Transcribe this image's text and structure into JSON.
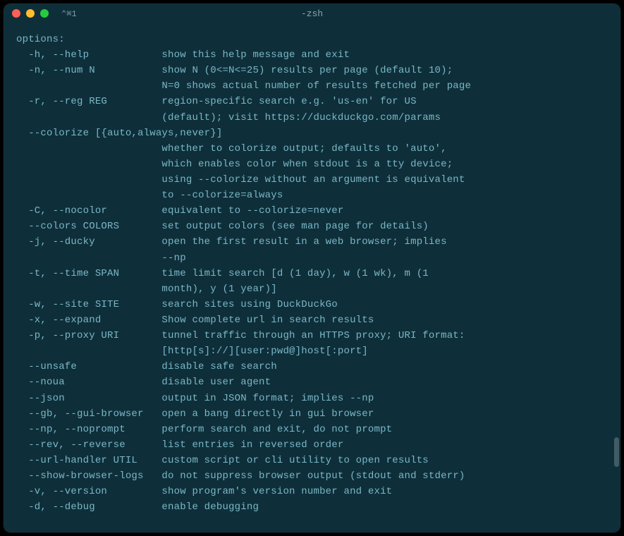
{
  "titlebar": {
    "tab_label": "⌘1",
    "icon_prefix": "⌃",
    "title": "-zsh"
  },
  "terminal": {
    "header": "options:",
    "options": [
      {
        "flag": "  -h, --help",
        "desc": [
          "show this help message and exit"
        ]
      },
      {
        "flag": "  -n, --num N",
        "desc": [
          "show N (0<=N<=25) results per page (default 10);",
          "N=0 shows actual number of results fetched per page"
        ]
      },
      {
        "flag": "  -r, --reg REG",
        "desc": [
          "region-specific search e.g. 'us-en' for US",
          "(default); visit https://duckduckgo.com/params"
        ]
      },
      {
        "flag": "  --colorize [{auto,always,never}]",
        "desc": [],
        "full_line": true
      },
      {
        "flag": "",
        "desc": [
          "whether to colorize output; defaults to 'auto',",
          "which enables color when stdout is a tty device;",
          "using --colorize without an argument is equivalent",
          "to --colorize=always"
        ]
      },
      {
        "flag": "  -C, --nocolor",
        "desc": [
          "equivalent to --colorize=never"
        ]
      },
      {
        "flag": "  --colors COLORS",
        "desc": [
          "set output colors (see man page for details)"
        ]
      },
      {
        "flag": "  -j, --ducky",
        "desc": [
          "open the first result in a web browser; implies",
          "--np"
        ]
      },
      {
        "flag": "  -t, --time SPAN",
        "desc": [
          "time limit search [d (1 day), w (1 wk), m (1",
          "month), y (1 year)]"
        ]
      },
      {
        "flag": "  -w, --site SITE",
        "desc": [
          "search sites using DuckDuckGo"
        ]
      },
      {
        "flag": "  -x, --expand",
        "desc": [
          "Show complete url in search results"
        ]
      },
      {
        "flag": "  -p, --proxy URI",
        "desc": [
          "tunnel traffic through an HTTPS proxy; URI format:",
          "[http[s]://][user:pwd@]host[:port]"
        ]
      },
      {
        "flag": "  --unsafe",
        "desc": [
          "disable safe search"
        ]
      },
      {
        "flag": "  --noua",
        "desc": [
          "disable user agent"
        ]
      },
      {
        "flag": "  --json",
        "desc": [
          "output in JSON format; implies --np"
        ]
      },
      {
        "flag": "  --gb, --gui-browser",
        "desc": [
          "open a bang directly in gui browser"
        ]
      },
      {
        "flag": "  --np, --noprompt",
        "desc": [
          "perform search and exit, do not prompt"
        ]
      },
      {
        "flag": "  --rev, --reverse",
        "desc": [
          "list entries in reversed order"
        ]
      },
      {
        "flag": "  --url-handler UTIL",
        "desc": [
          "custom script or cli utility to open results"
        ]
      },
      {
        "flag": "  --show-browser-logs",
        "desc": [
          "do not suppress browser output (stdout and stderr)"
        ]
      },
      {
        "flag": "  -v, --version",
        "desc": [
          "show program's version number and exit"
        ]
      },
      {
        "flag": "  -d, --debug",
        "desc": [
          "enable debugging"
        ]
      }
    ],
    "flag_col_width": 24
  }
}
